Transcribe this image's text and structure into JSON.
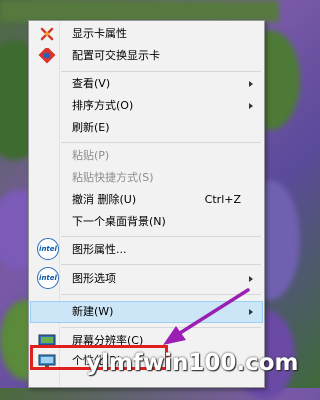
{
  "menu": {
    "items": [
      {
        "label": "显示卡属性",
        "icon": "graphics-properties-icon"
      },
      {
        "label": "配置可交换显示卡",
        "icon": "switchable-graphics-icon"
      },
      {
        "label": "查看(V)",
        "submenu": true
      },
      {
        "label": "排序方式(O)",
        "submenu": true
      },
      {
        "label": "刷新(E)"
      },
      {
        "label": "粘贴(P)",
        "disabled": true
      },
      {
        "label": "粘贴快捷方式(S)",
        "disabled": true
      },
      {
        "label": "撤消 删除(U)",
        "shortcut": "Ctrl+Z"
      },
      {
        "label": "下一个桌面背景(N)"
      },
      {
        "label": "图形属性...",
        "icon": "intel-icon"
      },
      {
        "label": "图形选项",
        "submenu": true,
        "icon": "intel-icon"
      },
      {
        "label": "新建(W)",
        "submenu": true,
        "highlighted": true
      },
      {
        "label": "屏幕分辨率(C)",
        "icon": "screen-resolution-icon"
      },
      {
        "label": "个性化(R)",
        "icon": "personalize-icon"
      }
    ],
    "intel_text": "intel"
  },
  "watermark": "ylmfwin100.com",
  "colors": {
    "menu_bg": "#f2f2f2",
    "highlight_bg": "#cde6f7",
    "annotation_red": "#e0201e",
    "annotation_arrow": "#9b1fb3"
  }
}
